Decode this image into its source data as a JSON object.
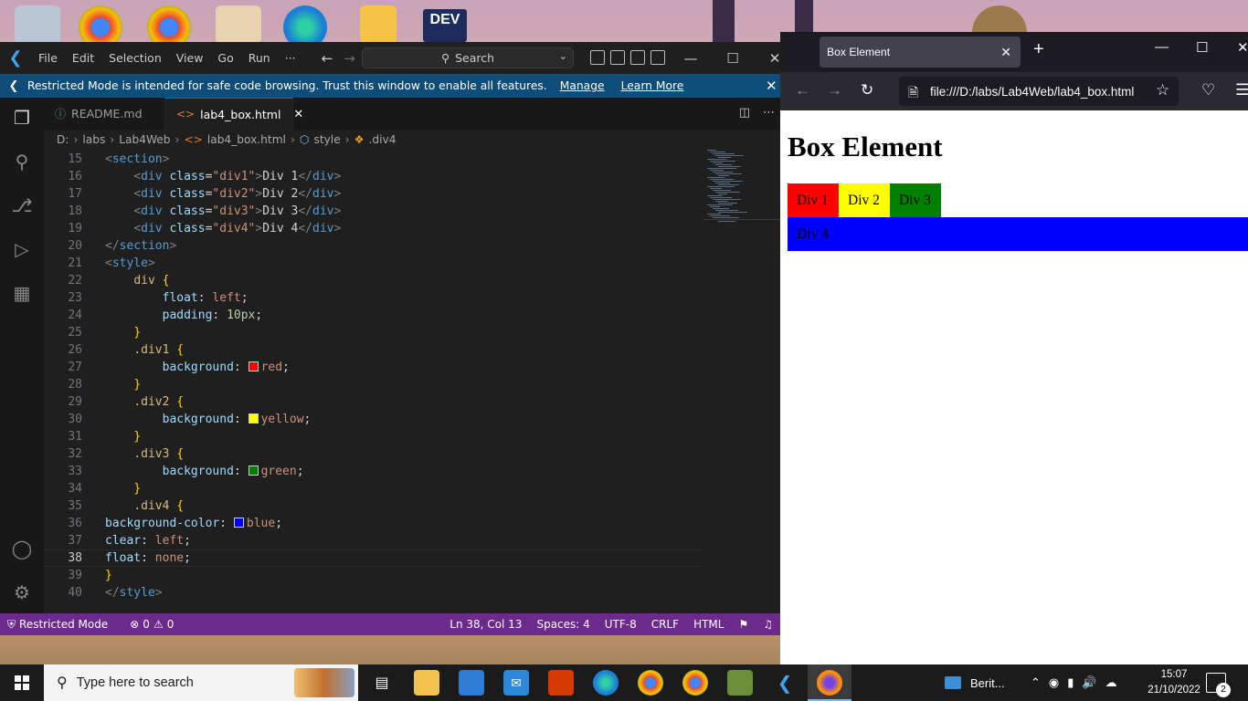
{
  "vscode": {
    "menu": [
      "File",
      "Edit",
      "Selection",
      "View",
      "Go",
      "Run",
      "···"
    ],
    "search_label": "Search",
    "banner": {
      "text": "Restricted Mode is intended for safe code browsing. Trust this window to enable all features.",
      "manage": "Manage",
      "learn_more": "Learn More"
    },
    "tabs": [
      {
        "label": "README.md",
        "active": false
      },
      {
        "label": "lab4_box.html",
        "active": true
      }
    ],
    "breadcrumb": [
      "D:",
      "labs",
      "Lab4Web",
      "lab4_box.html",
      "style",
      ".div4"
    ],
    "current_line": 38,
    "lines": [
      {
        "n": "15",
        "text": "<section>"
      },
      {
        "n": "16",
        "text": "    <div class=\"div1\">Div 1</div>"
      },
      {
        "n": "17",
        "text": "    <div class=\"div2\">Div 2</div>"
      },
      {
        "n": "18",
        "text": "    <div class=\"div3\">Div 3</div>"
      },
      {
        "n": "19",
        "text": "    <div class=\"div4\">Div 4</div>"
      },
      {
        "n": "20",
        "text": "</section>"
      },
      {
        "n": "21",
        "text": "<style>"
      },
      {
        "n": "22",
        "text": "    div {"
      },
      {
        "n": "23",
        "text": "        float: left;"
      },
      {
        "n": "24",
        "text": "        padding: 10px;"
      },
      {
        "n": "25",
        "text": "    }"
      },
      {
        "n": "26",
        "text": "    .div1 {"
      },
      {
        "n": "27",
        "text": "        background: red;"
      },
      {
        "n": "28",
        "text": "    }"
      },
      {
        "n": "29",
        "text": "    .div2 {"
      },
      {
        "n": "30",
        "text": "        background: yellow;"
      },
      {
        "n": "31",
        "text": "    }"
      },
      {
        "n": "32",
        "text": "    .div3 {"
      },
      {
        "n": "33",
        "text": "        background: green;"
      },
      {
        "n": "34",
        "text": "    }"
      },
      {
        "n": "35",
        "text": "    .div4 {"
      },
      {
        "n": "36",
        "text": "background-color: blue;"
      },
      {
        "n": "37",
        "text": "clear: left;"
      },
      {
        "n": "38",
        "text": "float: none;"
      },
      {
        "n": "39",
        "text": "}"
      },
      {
        "n": "40",
        "text": "</style>"
      }
    ],
    "status": {
      "mode": "Restricted Mode",
      "errors": "0",
      "warnings": "0",
      "position": "Ln 38, Col 13",
      "spaces": "Spaces: 4",
      "encoding": "UTF-8",
      "eol": "CRLF",
      "language": "HTML"
    },
    "colors": {
      "statusbar": "#6c2a8d",
      "banner": "#0e4d7a",
      "accent": "#0078d4"
    }
  },
  "firefox": {
    "tab_title": "Box Element",
    "url": "file:///D:/labs/Lab4Web/lab4_box.html",
    "page": {
      "heading": "Box Element",
      "boxes": [
        {
          "label": "Div 1",
          "color": "#ff0000"
        },
        {
          "label": "Div 2",
          "color": "#ffff00"
        },
        {
          "label": "Div 3",
          "color": "#008000"
        },
        {
          "label": "Div 4",
          "color": "#0000ff"
        }
      ]
    }
  },
  "taskbar": {
    "search_placeholder": "Type here to search",
    "news": "Berit...",
    "time": "15:07",
    "date": "21/10/2022",
    "notifications": "2"
  }
}
